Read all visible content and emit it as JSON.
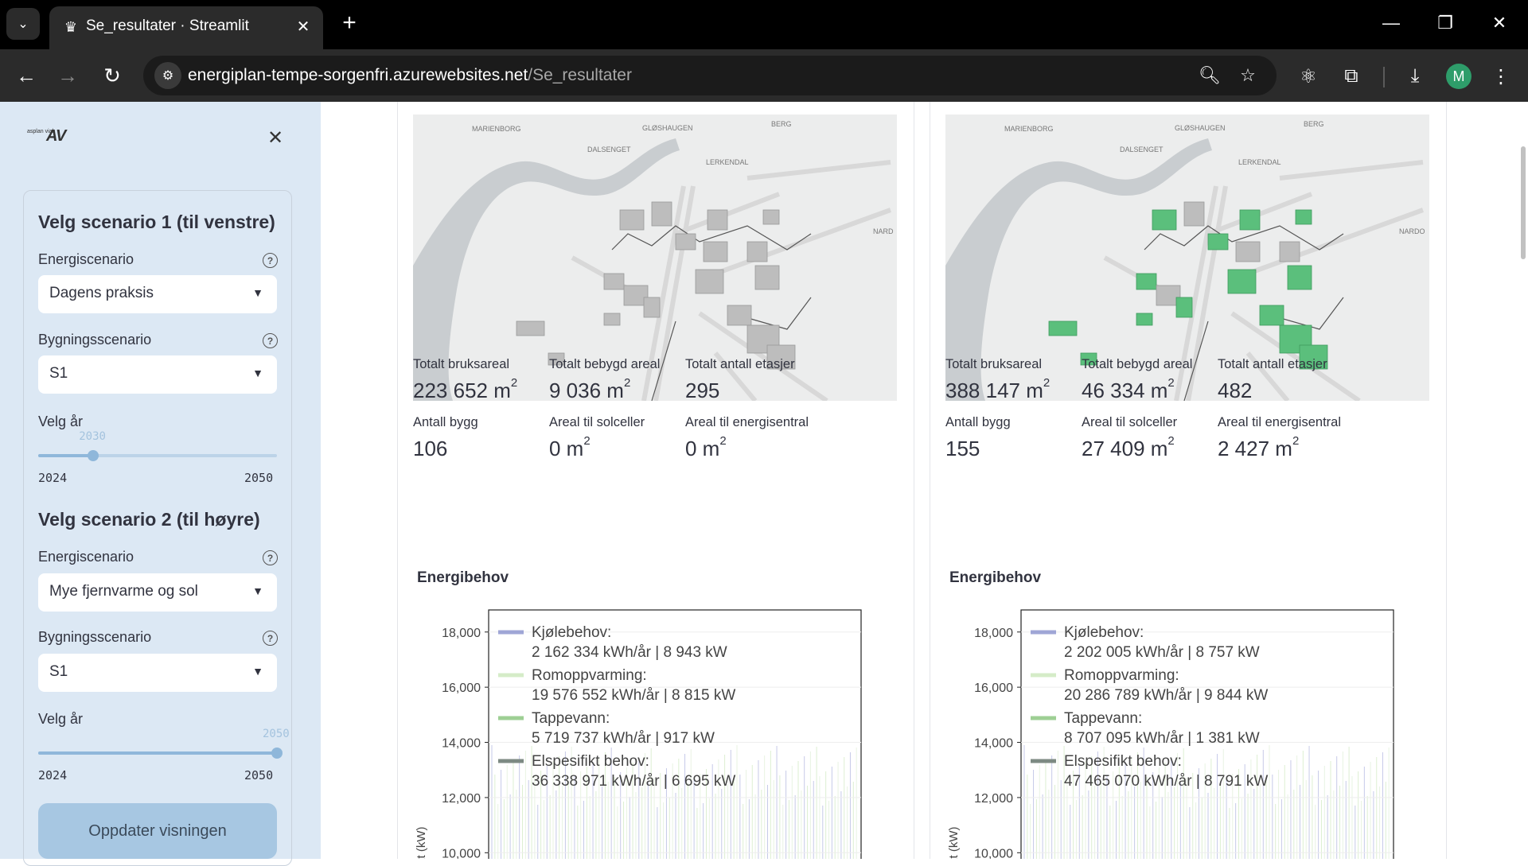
{
  "browser": {
    "tab_title": "Se_resultater · Streamlit",
    "url_host": "energiplan-tempe-sorgenfri.azurewebsites.net",
    "url_path": "/Se_resultater",
    "profile_initial": "M"
  },
  "sidebar": {
    "logo_small": "asplan viak",
    "logo_mark": "AV",
    "scenario1": {
      "heading": "Velg scenario 1 (til venstre)",
      "energy_label": "Energiscenario",
      "energy_value": "Dagens praksis",
      "building_label": "Bygningsscenario",
      "building_value": "S1",
      "year_label": "Velg år",
      "year_value": "2030",
      "year_fraction": 0.2308,
      "year_min": "2024",
      "year_max": "2050"
    },
    "scenario2": {
      "heading": "Velg scenario 2 (til høyre)",
      "energy_label": "Energiscenario",
      "energy_value": "Mye fjernvarme og sol",
      "building_label": "Bygningsscenario",
      "building_value": "S1",
      "year_label": "Velg år",
      "year_value": "2050",
      "year_fraction": 1.0,
      "year_min": "2024",
      "year_max": "2050"
    },
    "update_button": "Oppdater visningen"
  },
  "map_labels": [
    "MARIENBORG",
    "GLØSHAUGEN",
    "BERG",
    "DALSENGET",
    "LERKENDAL",
    "NARDO"
  ],
  "panels": [
    {
      "metrics": [
        {
          "label": "Totalt bruksareal",
          "value": "223 652 m",
          "unit_sup": "2"
        },
        {
          "label": "Totalt bebygd areal",
          "value": "9 036 m",
          "unit_sup": "2"
        },
        {
          "label": "Totalt antall etasjer",
          "value": "295",
          "unit_sup": ""
        },
        {
          "label": "Antall bygg",
          "value": "106",
          "unit_sup": ""
        },
        {
          "label": "Areal til solceller",
          "value": "0 m",
          "unit_sup": "2"
        },
        {
          "label": "Areal til energisentral",
          "value": "0 m",
          "unit_sup": "2"
        }
      ],
      "section_title": "Energibehov",
      "map_label_nardo": "NARD"
    },
    {
      "metrics": [
        {
          "label": "Totalt bruksareal",
          "value": "388 147 m",
          "unit_sup": "2"
        },
        {
          "label": "Totalt bebygd areal",
          "value": "46 334 m",
          "unit_sup": "2"
        },
        {
          "label": "Totalt antall etasjer",
          "value": "482",
          "unit_sup": ""
        },
        {
          "label": "Antall bygg",
          "value": "155",
          "unit_sup": ""
        },
        {
          "label": "Areal til solceller",
          "value": "27 409 m",
          "unit_sup": "2"
        },
        {
          "label": "Areal til energisentral",
          "value": "2 427 m",
          "unit_sup": "2"
        }
      ],
      "section_title": "Energibehov",
      "map_label_nardo": "NARDO"
    }
  ],
  "chart_data": [
    {
      "type": "area",
      "ylabel": "kt (kW)",
      "yticks": [
        "18,000",
        "16,000",
        "14,000",
        "12,000",
        "10,000"
      ],
      "ytick_values": [
        18000,
        16000,
        14000,
        12000,
        10000
      ],
      "ylim": [
        9000,
        18800
      ],
      "legend_position": "top-left",
      "series": [
        {
          "name": "Kjølebehov:",
          "detail": "2 162 334 kWh/år | 8 943 kW",
          "color": "#9fa6d6"
        },
        {
          "name": "Romoppvarming:",
          "detail": "19 576 552 kWh/år | 8 815 kW",
          "color": "#d5ecc8"
        },
        {
          "name": "Tappevann:",
          "detail": "5 719 737 kWh/år | 917 kW",
          "color": "#9ecf94"
        },
        {
          "name": "Elspesifikt behov:",
          "detail": "36 338 971 kWh/år | 6 695 kW",
          "color": "#7d8a83"
        }
      ]
    },
    {
      "type": "area",
      "ylabel": "kt (kW)",
      "yticks": [
        "18,000",
        "16,000",
        "14,000",
        "12,000",
        "10,000"
      ],
      "ytick_values": [
        18000,
        16000,
        14000,
        12000,
        10000
      ],
      "ylim": [
        9000,
        18800
      ],
      "legend_position": "top-left",
      "series": [
        {
          "name": "Kjølebehov:",
          "detail": "2 202 005 kWh/år | 8 757 kW",
          "color": "#9fa6d6"
        },
        {
          "name": "Romoppvarming:",
          "detail": "20 286 789 kWh/år | 9 844 kW",
          "color": "#d5ecc8"
        },
        {
          "name": "Tappevann:",
          "detail": "8 707 095 kWh/år | 1 381 kW",
          "color": "#9ecf94"
        },
        {
          "name": "Elspesifikt behov:",
          "detail": "47 465 070 kWh/år | 8 791 kW",
          "color": "#7d8a83"
        }
      ]
    }
  ]
}
